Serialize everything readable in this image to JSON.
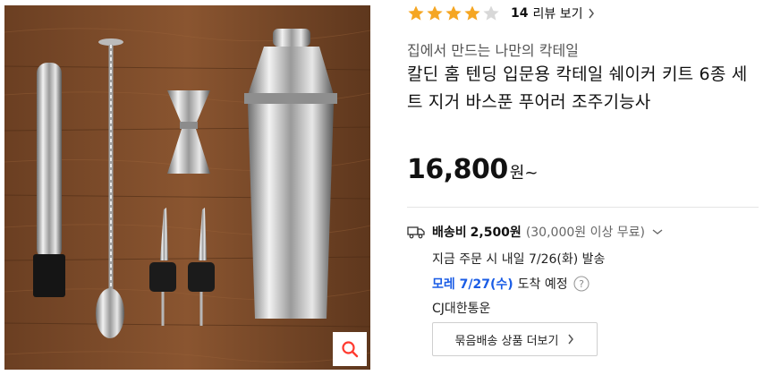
{
  "rating": {
    "value": 4,
    "max": 5,
    "count": "14",
    "link_label": "리뷰 보기"
  },
  "store": {
    "name": "집에서 만드는 나만의 칵테일"
  },
  "product": {
    "title": "칼딘 홈 텐딩 입문용 칵테일 쉐이커 키트 6종 세트 지거 바스푼 푸어러 조주기능사"
  },
  "price": {
    "amount": "16,800",
    "unit": "원~"
  },
  "shipping": {
    "label": "배송비",
    "fee": "2,500원",
    "free_condition": "(30,000원 이상 무료)",
    "depart": "지금 주문 시 내일 7/26(화) 발송",
    "arrive_date": "모레 7/27(수)",
    "arrive_suffix": "도착 예정",
    "carrier": "CJ대한통운"
  },
  "bundle_button": {
    "label": "묶음배송 상품 더보기"
  },
  "colors": {
    "star": "#f5a623",
    "star_empty": "#d8d8d8",
    "accent_blue": "#1a5ce5",
    "zoom": "#ff3a2f"
  },
  "icons": [
    "star-icon",
    "chevron-right-icon",
    "truck-icon",
    "chevron-down-icon",
    "help-icon",
    "search-icon"
  ]
}
